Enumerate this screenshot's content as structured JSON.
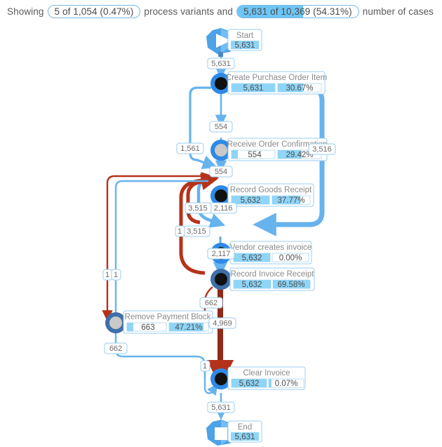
{
  "header": {
    "prefix": "Showing",
    "variants_pill": {
      "text": "5 of 1,054 (0.47%)",
      "fill_percent": 0
    },
    "middle": "process variants and",
    "cases_pill": {
      "text": "5,631 of 10,369 (54.31%)",
      "fill_percent": 54.31
    },
    "suffix": "number of cases"
  },
  "diagram": {
    "type": "process-map",
    "colors": {
      "node_ring": "#2e8ae6",
      "node_ring_dark": "#3f6fa8",
      "node_core": "#111111",
      "node_core_light": "#c9c9c9",
      "edge_blue": "#66b3ee",
      "edge_red": "#b5321a",
      "badge_fill": "#8ed5f7",
      "terminal_blue": "#4da2e8",
      "label_border": "#9bcdf0",
      "title_text": "#8a8a8a"
    },
    "nodes": [
      {
        "id": "start",
        "kind": "terminal-start",
        "title": "Start",
        "value": "5,631",
        "percent": null,
        "value_fill_percent": 100
      },
      {
        "id": "create_po_item",
        "kind": "activity",
        "title": "Create Purchase Order Item",
        "value": "5,631",
        "percent": "30.67%",
        "value_fill_percent": 100,
        "percent_fill_percent": 58,
        "core": "dark"
      },
      {
        "id": "receive_order_conf",
        "kind": "activity",
        "title": "Receive Order Confirmation",
        "value": "554",
        "percent": "29.42%",
        "value_fill_percent": 13,
        "percent_fill_percent": 55,
        "core": "light"
      },
      {
        "id": "record_goods_receipt",
        "kind": "activity",
        "title": "Record Goods Receipt",
        "value": "5,632",
        "percent": "37.77%",
        "value_fill_percent": 100,
        "percent_fill_percent": 70,
        "core": "dark"
      },
      {
        "id": "vendor_creates_invoice",
        "kind": "activity",
        "title": "Vendor creates invoice",
        "value": "5,632",
        "percent": "0.00%",
        "value_fill_percent": 100,
        "percent_fill_percent": 0,
        "core": "dark"
      },
      {
        "id": "record_invoice_receipt",
        "kind": "activity",
        "title": "Record Invoice Receipt",
        "value": "5,632",
        "percent": "69.58%",
        "value_fill_percent": 100,
        "percent_fill_percent": 100,
        "core": "dark"
      },
      {
        "id": "remove_payment_block",
        "kind": "activity",
        "title": "Remove Payment Block",
        "value": "663",
        "percent": "47.21%",
        "value_fill_percent": 15,
        "percent_fill_percent": 88,
        "core": "light"
      },
      {
        "id": "clear_invoice",
        "kind": "activity",
        "title": "Clear Invoice",
        "value": "5,632",
        "percent": "0.07%",
        "value_fill_percent": 100,
        "percent_fill_percent": 4,
        "core": "dark"
      },
      {
        "id": "end",
        "kind": "terminal-end",
        "title": "End",
        "value": "5,631",
        "percent": null,
        "value_fill_percent": 100
      }
    ],
    "edges": [
      {
        "id": "e1",
        "from": "start",
        "to": "create_po_item",
        "label": "5,631",
        "color": "blue"
      },
      {
        "id": "e2",
        "from": "create_po_item",
        "to": "receive_order_conf",
        "label": "554",
        "color": "blue"
      },
      {
        "id": "e3",
        "from": "create_po_item",
        "to": "record_goods_receipt",
        "label": "1,561",
        "color": "blue"
      },
      {
        "id": "e4",
        "from": "receive_order_conf",
        "to": "record_goods_receipt",
        "label": "554",
        "color": "blue"
      },
      {
        "id": "e5",
        "from": "create_po_item",
        "to": "vendor_creates_invoice",
        "label": "3,516",
        "color": "blue"
      },
      {
        "id": "e6",
        "from": "record_goods_receipt",
        "to": "vendor_creates_invoice",
        "label": "2,116",
        "color": "blue"
      },
      {
        "id": "e7",
        "from": "vendor_creates_invoice",
        "to": "record_goods_receipt",
        "label": "3,515",
        "color": "red"
      },
      {
        "id": "e8",
        "from": "record_invoice_receipt",
        "to": "record_goods_receipt",
        "label": "3,515",
        "color": "red"
      },
      {
        "id": "e9",
        "from": "record_goods_receipt",
        "to": "remove_payment_block",
        "label": "1",
        "color": "red"
      },
      {
        "id": "e10",
        "from": "record_goods_receipt",
        "to": "remove_payment_block",
        "label": "1",
        "color": "blue"
      },
      {
        "id": "e11",
        "from": "vendor_creates_invoice",
        "to": "record_invoice_receipt",
        "label": "2,117",
        "color": "blue"
      },
      {
        "id": "e12",
        "from": "record_invoice_receipt",
        "to": "remove_payment_block",
        "label": "662",
        "color": "red"
      },
      {
        "id": "e13",
        "from": "record_invoice_receipt",
        "to": "clear_invoice",
        "label": "4,969",
        "color": "red"
      },
      {
        "id": "e14",
        "from": "remove_payment_block",
        "to": "clear_invoice",
        "label": "662",
        "color": "blue"
      },
      {
        "id": "e15",
        "from": "remove_payment_block",
        "to": "clear_invoice",
        "label": "1",
        "color": "blue"
      },
      {
        "id": "e16",
        "from": "clear_invoice",
        "to": "end",
        "label": "5,631",
        "color": "blue"
      }
    ]
  }
}
